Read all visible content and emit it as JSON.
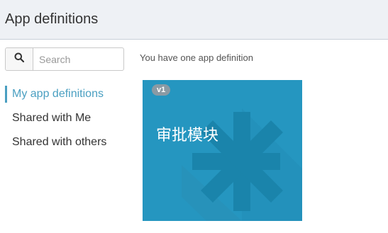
{
  "header": {
    "title": "App definitions"
  },
  "search": {
    "placeholder": "Search",
    "value": "",
    "icon": "search-icon"
  },
  "nav": {
    "items": [
      {
        "label": "My app definitions",
        "active": true
      },
      {
        "label": "Shared with Me",
        "active": false
      },
      {
        "label": "Shared with others",
        "active": false
      }
    ]
  },
  "main": {
    "count_text": "You have one app definition",
    "apps": [
      {
        "name": "审批模块",
        "version": "v1",
        "tile_color": "#2596c0",
        "icon": "asterisk-icon"
      }
    ]
  },
  "colors": {
    "accent": "#4a9fc1",
    "header_bg": "#eef1f5"
  }
}
